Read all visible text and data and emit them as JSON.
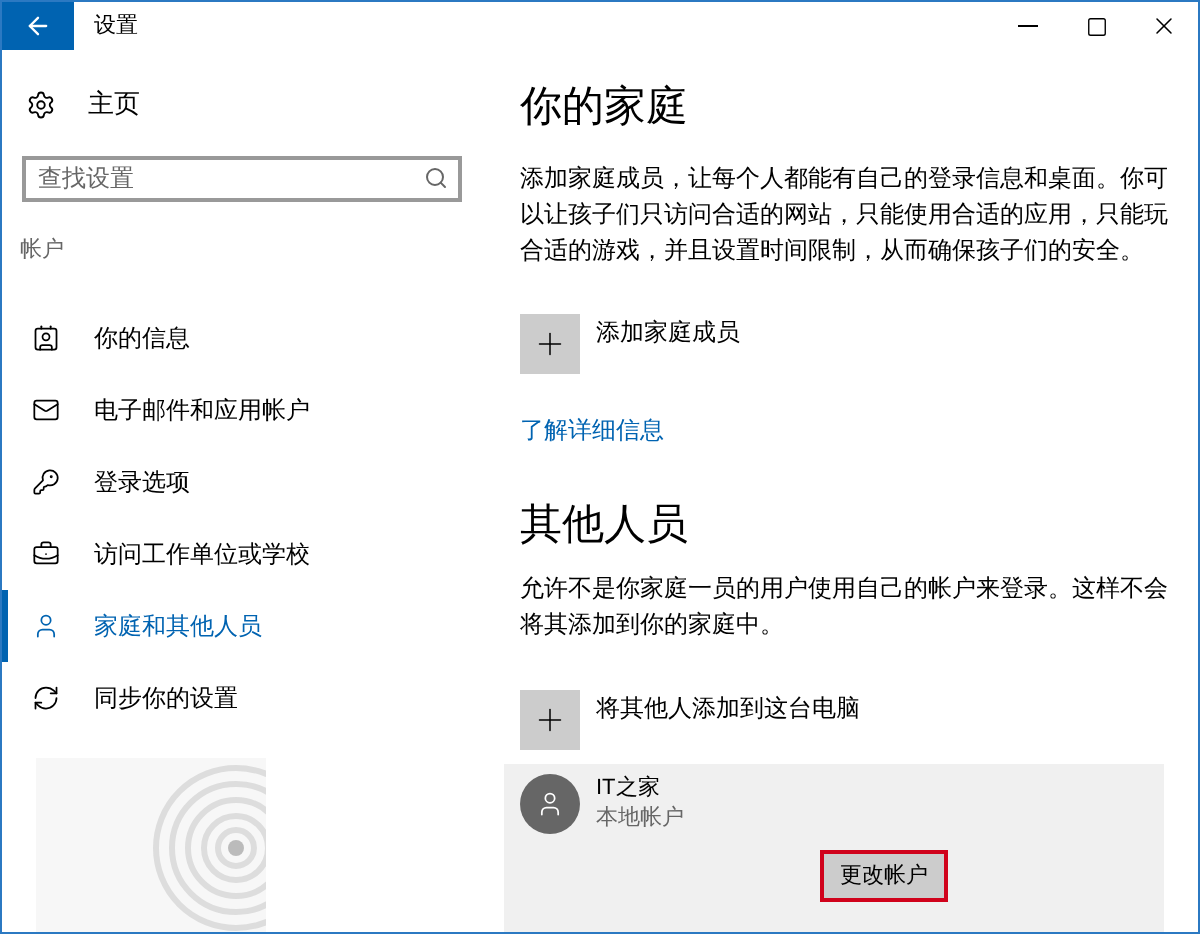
{
  "window": {
    "title": "设置"
  },
  "sidebar": {
    "home": "主页",
    "search": {
      "placeholder": "查找设置"
    },
    "section": "帐户",
    "items": [
      {
        "label": "你的信息",
        "selected": false
      },
      {
        "label": "电子邮件和应用帐户",
        "selected": false
      },
      {
        "label": "登录选项",
        "selected": false
      },
      {
        "label": "访问工作单位或学校",
        "selected": false
      },
      {
        "label": "家庭和其他人员",
        "selected": true
      },
      {
        "label": "同步你的设置",
        "selected": false
      }
    ]
  },
  "family": {
    "title": "你的家庭",
    "description": "添加家庭成员，让每个人都能有自己的登录信息和桌面。你可以让孩子们只访问合适的网站，只能使用合适的应用，只能玩合适的游戏，并且设置时间限制，从而确保孩子们的安全。",
    "add_label": "添加家庭成员",
    "link": "了解详细信息"
  },
  "others": {
    "title": "其他人员",
    "description": "允许不是你家庭一员的用户使用自己的帐户来登录。这样不会将其添加到你的家庭中。",
    "add_label": "将其他人添加到这台电脑",
    "account": {
      "name": "IT之家",
      "type": "本地帐户",
      "button": {
        "label": "更改帐户",
        "highlighted": true
      }
    }
  }
}
